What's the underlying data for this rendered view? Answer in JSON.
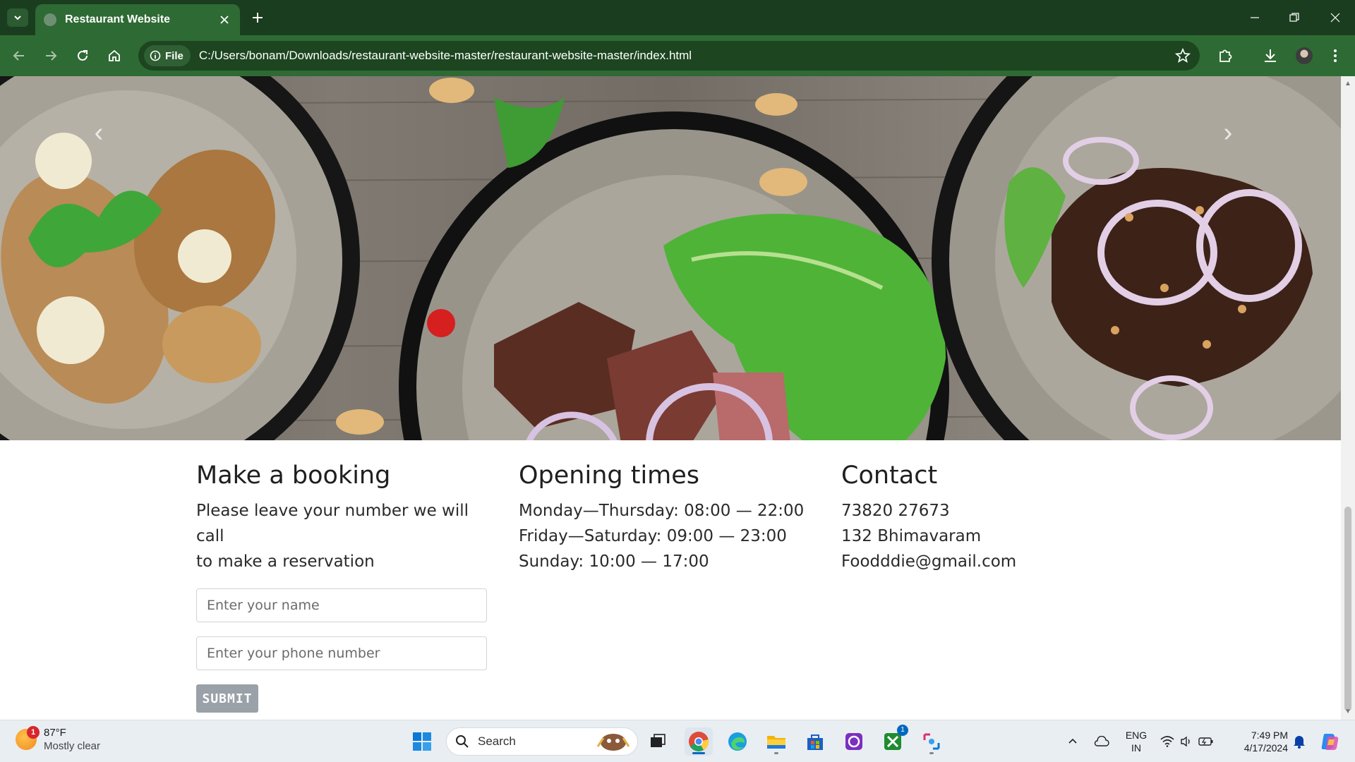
{
  "browser": {
    "tab_title": "Restaurant Website",
    "file_chip": "File",
    "url": "C:/Users/bonam/Downloads/restaurant-website-master/restaurant-website-master/index.html"
  },
  "page": {
    "booking": {
      "heading": "Make a booking",
      "text_line1": "Please leave your number we will call",
      "text_line2": "to make a reservation",
      "name_placeholder": "Enter your name",
      "phone_placeholder": "Enter your phone number",
      "submit_label": "SUBMIT"
    },
    "opening": {
      "heading": "Opening times",
      "lines": [
        "Monday—Thursday: 08:00 — 22:00",
        "Friday—Saturday: 09:00 — 23:00",
        "Sunday: 10:00 — 17:00"
      ]
    },
    "contact": {
      "heading": "Contact",
      "phone": "73820 27673",
      "address": "132 Bhimavaram",
      "email": "Foodddie@gmail.com"
    }
  },
  "taskbar": {
    "weather_temp": "87°F",
    "weather_desc": "Mostly clear",
    "weather_badge": "1",
    "search_label": "Search",
    "xbox_badge": "1",
    "lang_top": "ENG",
    "lang_bottom": "IN",
    "time": "7:49 PM",
    "date": "4/17/2024"
  },
  "colors": {
    "tabbar": "#1a3d1f",
    "toolbar": "#2e6a33",
    "submit": "#9aa1a8"
  }
}
